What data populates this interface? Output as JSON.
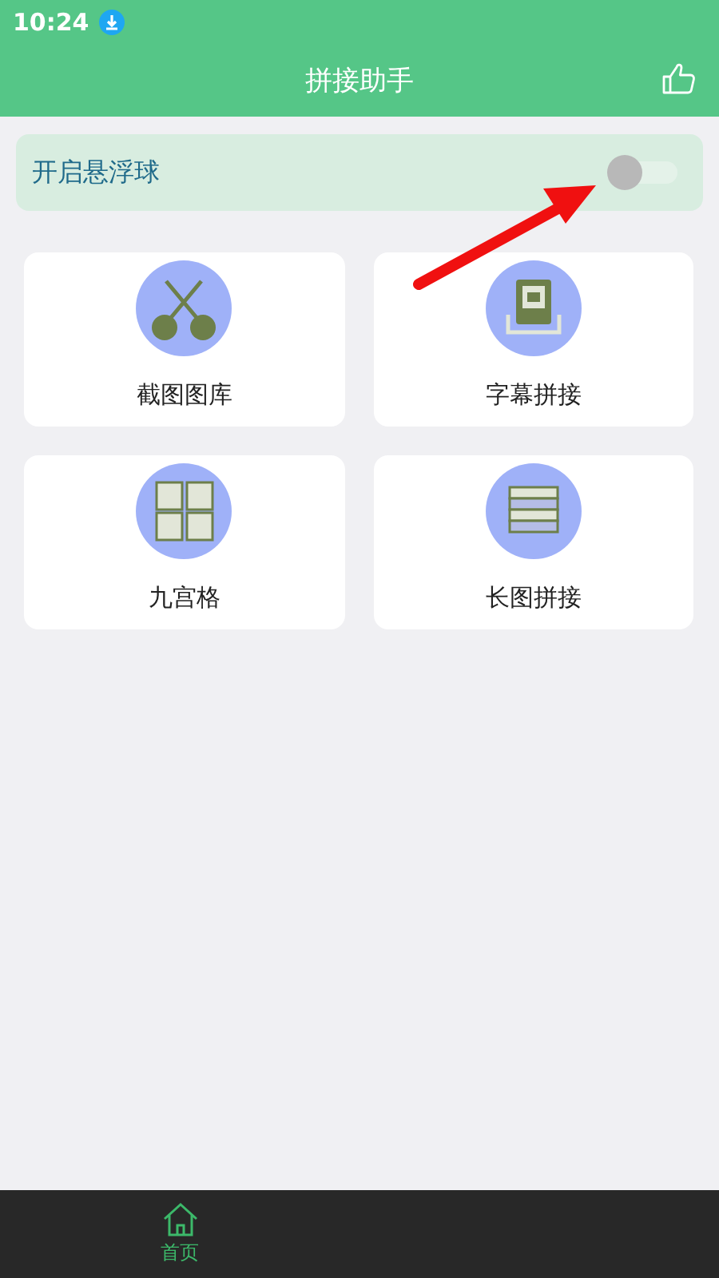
{
  "status_bar": {
    "time": "10:24"
  },
  "header": {
    "title": "拼接助手"
  },
  "floating_ball": {
    "label": "开启悬浮球",
    "on": false
  },
  "tools": [
    {
      "label": "截图图库",
      "kind": "scissors"
    },
    {
      "label": "字幕拼接",
      "kind": "subtitle"
    },
    {
      "label": "九宫格",
      "kind": "grid"
    },
    {
      "label": "长图拼接",
      "kind": "stack"
    }
  ],
  "bottom_nav": [
    {
      "label": "首页",
      "selected": true
    }
  ]
}
